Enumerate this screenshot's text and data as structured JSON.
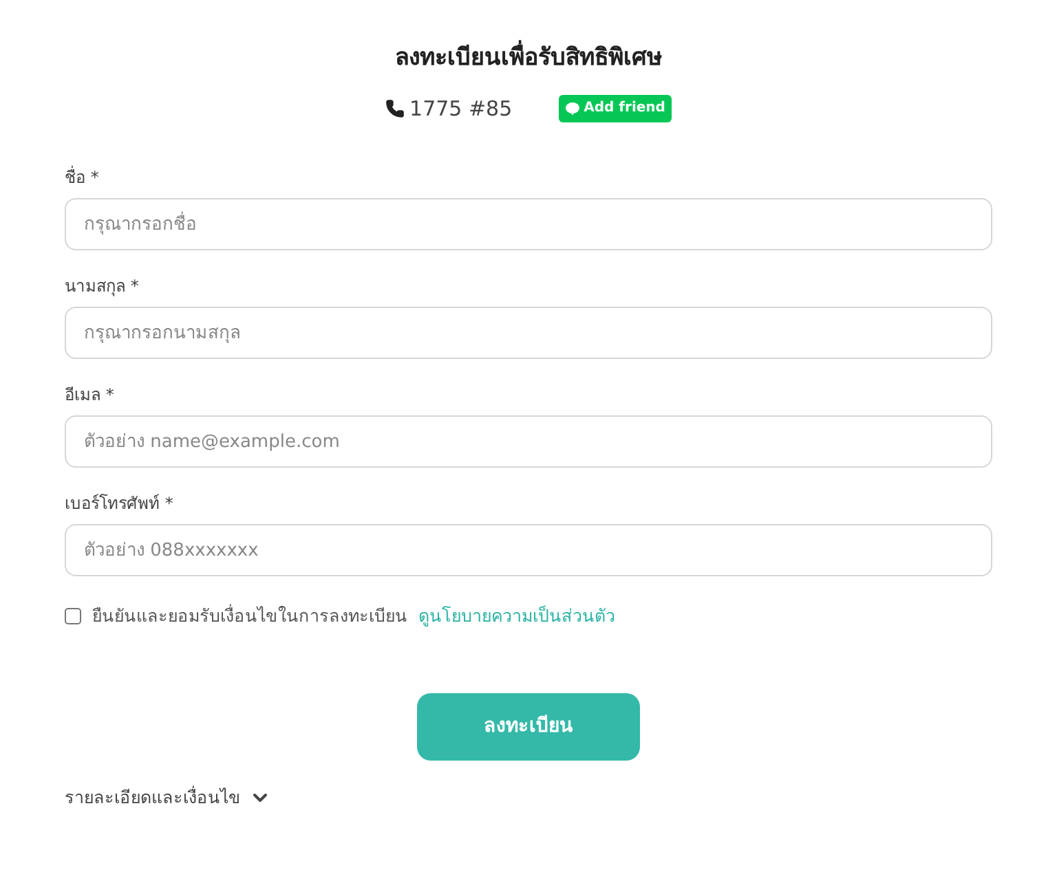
{
  "title": "ลงทะเบียนเพื่อรับสิทธิพิเศษ",
  "phone": "1775 #85",
  "add_friend": "Add friend",
  "fields": [
    {
      "label": "ชื่อ *",
      "placeholder": "กรุณากรอกชื่อ"
    },
    {
      "label": "นามสกุล *",
      "placeholder": "กรุณากรอกนามสกุล"
    },
    {
      "label": "อีเมล *",
      "placeholder": "ตัวอย่าง name@example.com"
    },
    {
      "label": "เบอร์โทรศัพท์ *",
      "placeholder": "ตัวอย่าง 088xxxxxxx"
    }
  ],
  "consent": {
    "checked": false,
    "text": "ยืนยันและยอมรับเงื่อนไขในการลงทะเบียน",
    "link": "ดูนโยบายความเป็นส่วนตัว"
  },
  "submit": "ลงทะเบียน",
  "details": {
    "label": "รายละเอียดและเงื่อนไข",
    "expanded": false
  }
}
